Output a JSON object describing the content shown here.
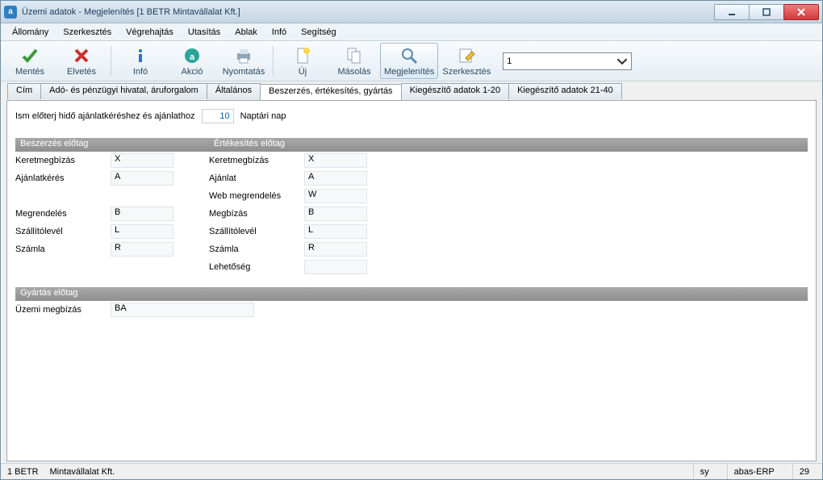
{
  "window": {
    "title": "Üzemi adatok - Megjelenítés  [1  BETR   Mintavállalat Kft.]"
  },
  "menu": {
    "allomany": "Állomány",
    "szerkesztes": "Szerkesztés",
    "vegrehajtas": "Végrehajtás",
    "utasitas": "Utasítás",
    "ablak": "Ablak",
    "info": "Infó",
    "segitseg": "Segítség"
  },
  "toolbar": {
    "mentes": "Mentés",
    "elvetes": "Elvetés",
    "info": "Infó",
    "akcio": "Akció",
    "nyomtatas": "Nyomtatás",
    "uj": "Új",
    "masolas": "Másolás",
    "megjelenites": "Megjelenítés",
    "szerkesztes": "Szerkesztés",
    "combo_value": "1"
  },
  "tabs": {
    "cim": "Cím",
    "ado": "Adó- és pénzügyi hivatal, áruforgalom",
    "altalanos": "Általános",
    "beszerzes": "Beszerzés, értékesítés, gyártás",
    "kieg1": "Kiegészítő adatok 1-20",
    "kieg2": "Kiegészítő adatok 21-40"
  },
  "form": {
    "isme_label": "Ism előterj hidő ajánlatkéréshez és ajánlathoz",
    "isme_value": "10",
    "naptari_nap": "Naptári nap",
    "sec_beszerzes": "Beszerzés előtag",
    "sec_ertekesites": "Értékesítés előtag",
    "sec_gyartas": "Gyártás előtag",
    "b": {
      "keretmegbizas_l": "Keretmegbízás",
      "keretmegbizas_v": "X",
      "ajanlatkeres_l": "Ajánlatkérés",
      "ajanlatkeres_v": "A",
      "megrendeles_l": "Megrendelés",
      "megrendeles_v": "B",
      "szallitolevel_l": "Szállítólevél",
      "szallitolevel_v": "L",
      "szamla_l": "Számla",
      "szamla_v": "R"
    },
    "e": {
      "keretmegbizas_l": "Keretmegbízás",
      "keretmegbizas_v": "X",
      "ajanlat_l": "Ajánlat",
      "ajanlat_v": "A",
      "web_l": "Web megrendelés",
      "web_v": "W",
      "megbizas_l": "Megbízás",
      "megbizas_v": "B",
      "szallitolevel_l": "Szállítólevél",
      "szallitolevel_v": "L",
      "szamla_l": "Számla",
      "szamla_v": "R",
      "lehetoseg_l": "Lehetőség",
      "lehetoseg_v": ""
    },
    "g": {
      "uzemi_l": "Üzemi megbízás",
      "uzemi_v": "BA"
    }
  },
  "status": {
    "left1": "1 BETR",
    "left2": "Mintavállalat Kft.",
    "r1": "sy",
    "r2": "abas-ERP",
    "r3": "29"
  }
}
